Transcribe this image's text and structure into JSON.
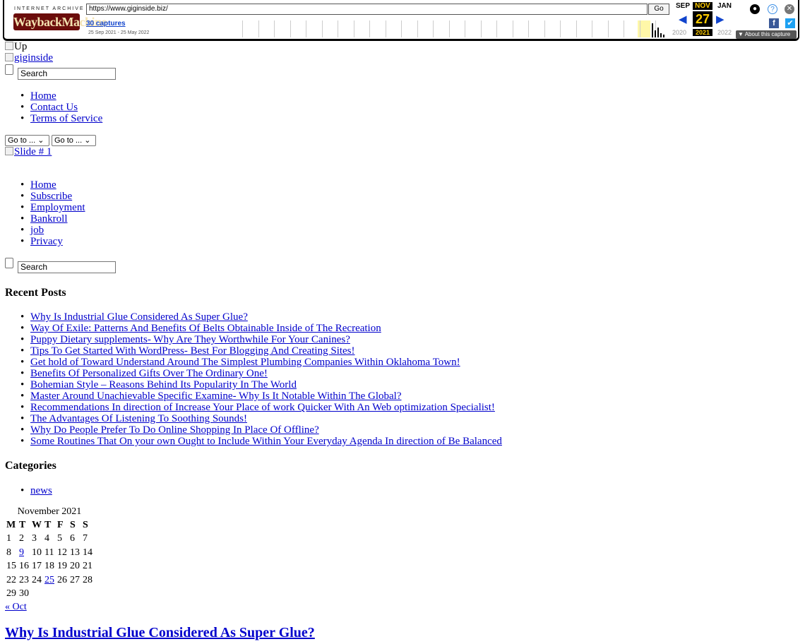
{
  "wayback": {
    "ia_label": "INTERNET ARCHIVE",
    "logo_text": "WaybackMachine",
    "url": "https://www.giginside.biz/",
    "go_label": "Go",
    "captures": "30 captures",
    "date_range": "25 Sep 2021 - 25 May 2022",
    "prev_month": "SEP",
    "cur_month": "NOV",
    "next_month": "JAN",
    "day": "27",
    "prev_year": "2020",
    "cur_year": "2021",
    "next_year": "2022",
    "about": "About this capture",
    "accent_color": "#ffcc00"
  },
  "page": {
    "up_alt": "Up",
    "logo_alt": "giginside",
    "search_value": "Search",
    "top_nav": [
      "Home",
      "Contact Us",
      "Terms of Service"
    ],
    "goto_1": "Go to ...",
    "goto_2": "Go to ...",
    "slide_alt": "Slide # 1",
    "main_nav": [
      "Home",
      "Subscribe",
      "Employment",
      "Bankroll",
      "job",
      "Privacy"
    ],
    "search2_value": "Search",
    "recent_heading": "Recent Posts",
    "recent_posts": [
      "Why Is Industrial Glue Considered As Super Glue?",
      "Way Of Exile: Patterns And Benefits Of Belts Obtainable Inside of The Recreation",
      "Puppy Dietary supplements- Why Are They Worthwhile For Your Canines?",
      "Tips To Get Started With WordPress- Best For Blogging And Creating Sites!",
      "Get hold of Toward Understand Around The Simplest Plumbing Companies Within Oklahoma Town!",
      "Benefits Of Personalized Gifts Over The Ordinary One!",
      "Bohemian Style – Reasons Behind Its Popularity In The World",
      "Master Around Unachievable Specific Examine- Why Is It Notable Within The Global?",
      "Recommendations In direction of Increase Your Place of work Quicker With An Web optimization Specialist!",
      "The Advantages Of Listening To Soothing Sounds!",
      "Why Do People Prefer To Do Online Shopping In Place Of Offline?",
      "Some Routines That On your own Ought to Include Within Your Everyday Agenda In direction of Be Balanced"
    ],
    "categories_heading": "Categories",
    "categories": [
      "news"
    ],
    "calendar": {
      "caption": "November 2021",
      "days": [
        "M",
        "T",
        "W",
        "T",
        "F",
        "S",
        "S"
      ],
      "rows": [
        [
          "1",
          "2",
          "3",
          "4",
          "5",
          "6",
          "7"
        ],
        [
          "8",
          "9",
          "10",
          "11",
          "12",
          "13",
          "14"
        ],
        [
          "15",
          "16",
          "17",
          "18",
          "19",
          "20",
          "21"
        ],
        [
          "22",
          "23",
          "24",
          "25",
          "26",
          "27",
          "28"
        ],
        [
          "29",
          "30",
          "",
          "",
          "",
          "",
          ""
        ]
      ],
      "links": [
        "9",
        "25"
      ],
      "prev": "« Oct"
    },
    "post_title": "Why Is Industrial Glue Considered As Super Glue?"
  }
}
